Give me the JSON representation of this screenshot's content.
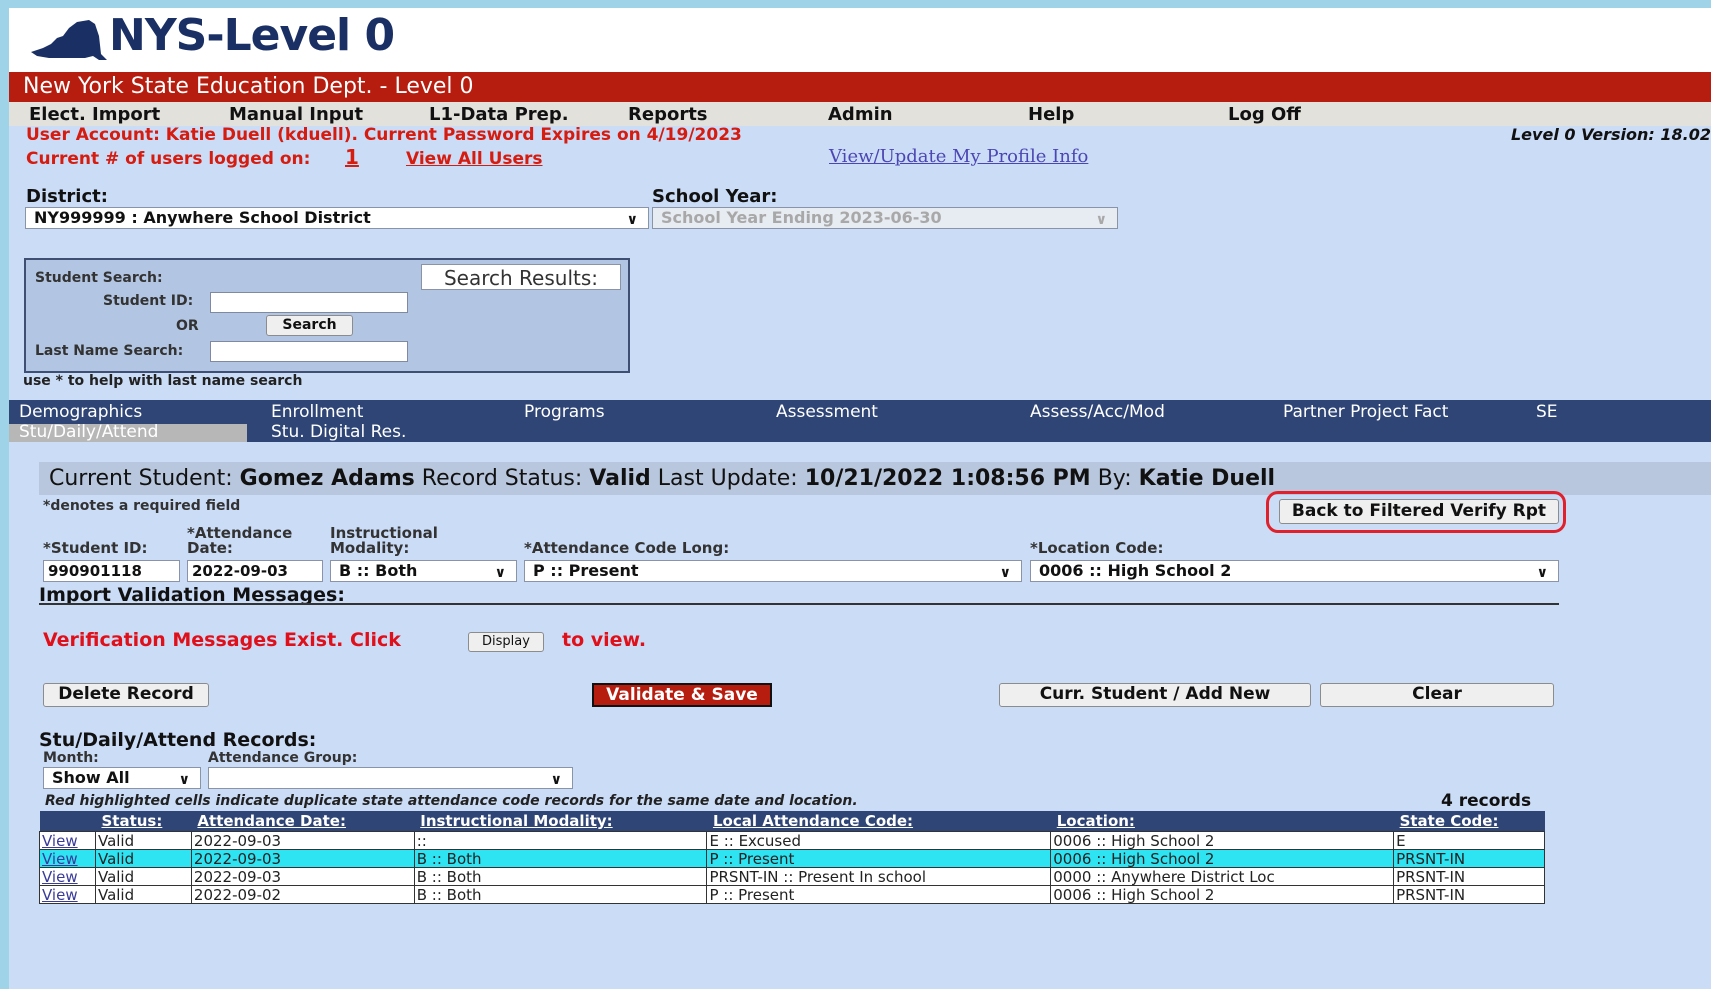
{
  "header": {
    "logo_text": "NYS-Level 0",
    "app_title": "New York State Education Dept. - Level 0"
  },
  "menu": [
    "Elect. Import",
    "Manual Input",
    "L1-Data Prep.",
    "Reports",
    "Admin",
    "Help",
    "Log Off"
  ],
  "account": {
    "info": "User Account: Katie Duell (kduell). Current Password Expires on 4/19/2023",
    "version": "Level 0 Version: 18.02",
    "users_label": "Current # of users logged on:",
    "users_count": "1",
    "view_all_users": "View All Users",
    "profile_link": "View/Update My Profile Info"
  },
  "filters": {
    "district_label": "District:",
    "district_value": "NY999999 : Anywhere School District",
    "school_year_label": "School Year:",
    "school_year_value": "School Year Ending 2023-06-30"
  },
  "student_search": {
    "title": "Student Search:",
    "student_id_label": "Student ID:",
    "or_label": "OR",
    "search_button": "Search",
    "last_name_label": "Last Name Search:",
    "results_label": "Search Results:",
    "hint": "use * to help with last name search"
  },
  "tabs": {
    "row1": [
      "Demographics",
      "Enrollment",
      "Programs",
      "Assessment",
      "Assess/Acc/Mod",
      "Partner Project Fact",
      "SE"
    ],
    "row2": [
      "Stu/Daily/Attend",
      "Stu. Digital Res."
    ],
    "active": "Stu/Daily/Attend"
  },
  "current_student": {
    "label": "Current Student:",
    "name": "Gomez Adams",
    "status_label": "Record Status:",
    "status": "Valid",
    "update_label": "Last Update:",
    "update": "10/21/2022 1:08:56 PM",
    "by_label": "By:",
    "by": "Katie Duell"
  },
  "form": {
    "required_note": "*denotes a required field",
    "back_button": "Back to Filtered Verify Rpt",
    "student_id_label": "*Student ID:",
    "student_id": "990901118",
    "att_date_label_1": "*Attendance",
    "att_date_label_2": "Date:",
    "att_date": "2022-09-03",
    "modality_label_1": "Instructional",
    "modality_label_2": "Modality:",
    "modality": "B :: Both",
    "att_code_label": "*Attendance Code Long:",
    "att_code": "P :: Present",
    "location_label": "*Location Code:",
    "location": "0006 :: High School 2"
  },
  "validation": {
    "title": "Import Validation Messages:",
    "message_pre": "Verification Messages Exist. Click",
    "display_button": "Display",
    "message_post": "to view."
  },
  "actions": {
    "delete": "Delete Record",
    "validate_save": "Validate & Save",
    "add_new": "Curr. Student / Add New",
    "clear": "Clear"
  },
  "records": {
    "title": "Stu/Daily/Attend Records:",
    "month_label": "Month:",
    "month_value": "Show All",
    "group_label": "Attendance Group:",
    "group_value": "",
    "note": "Red highlighted cells indicate duplicate state attendance code records for the same date and location.",
    "count": "4 records",
    "columns": [
      "",
      "Status:",
      "Attendance Date:",
      "Instructional Modality:",
      "Local Attendance Code:",
      "Location:",
      "State Code:"
    ],
    "rows": [
      {
        "view": "View",
        "status": "Valid",
        "date": "2022-09-03",
        "modality": "::",
        "local_code": "E :: Excused",
        "location": "0006 :: High School 2",
        "state_code": "E"
      },
      {
        "view": "View",
        "status": "Valid",
        "date": "2022-09-03",
        "modality": "B :: Both",
        "local_code": "P :: Present",
        "location": "0006 :: High School 2",
        "state_code": "PRSNT-IN"
      },
      {
        "view": "View",
        "status": "Valid",
        "date": "2022-09-03",
        "modality": "B :: Both",
        "local_code": "PRSNT-IN :: Present In school",
        "location": "0000 :: Anywhere District Loc",
        "state_code": "PRSNT-IN"
      },
      {
        "view": "View",
        "status": "Valid",
        "date": "2022-09-02",
        "modality": "B :: Both",
        "local_code": "P :: Present",
        "location": "0006 :: High School 2",
        "state_code": "PRSNT-IN"
      }
    ]
  },
  "colors": {
    "red_bar": "#b71d0f",
    "nav_blue": "#2f4576",
    "page_bg": "#cbdcf7",
    "highlight_row": "#2ee3f2",
    "error_red": "#e0101a"
  }
}
